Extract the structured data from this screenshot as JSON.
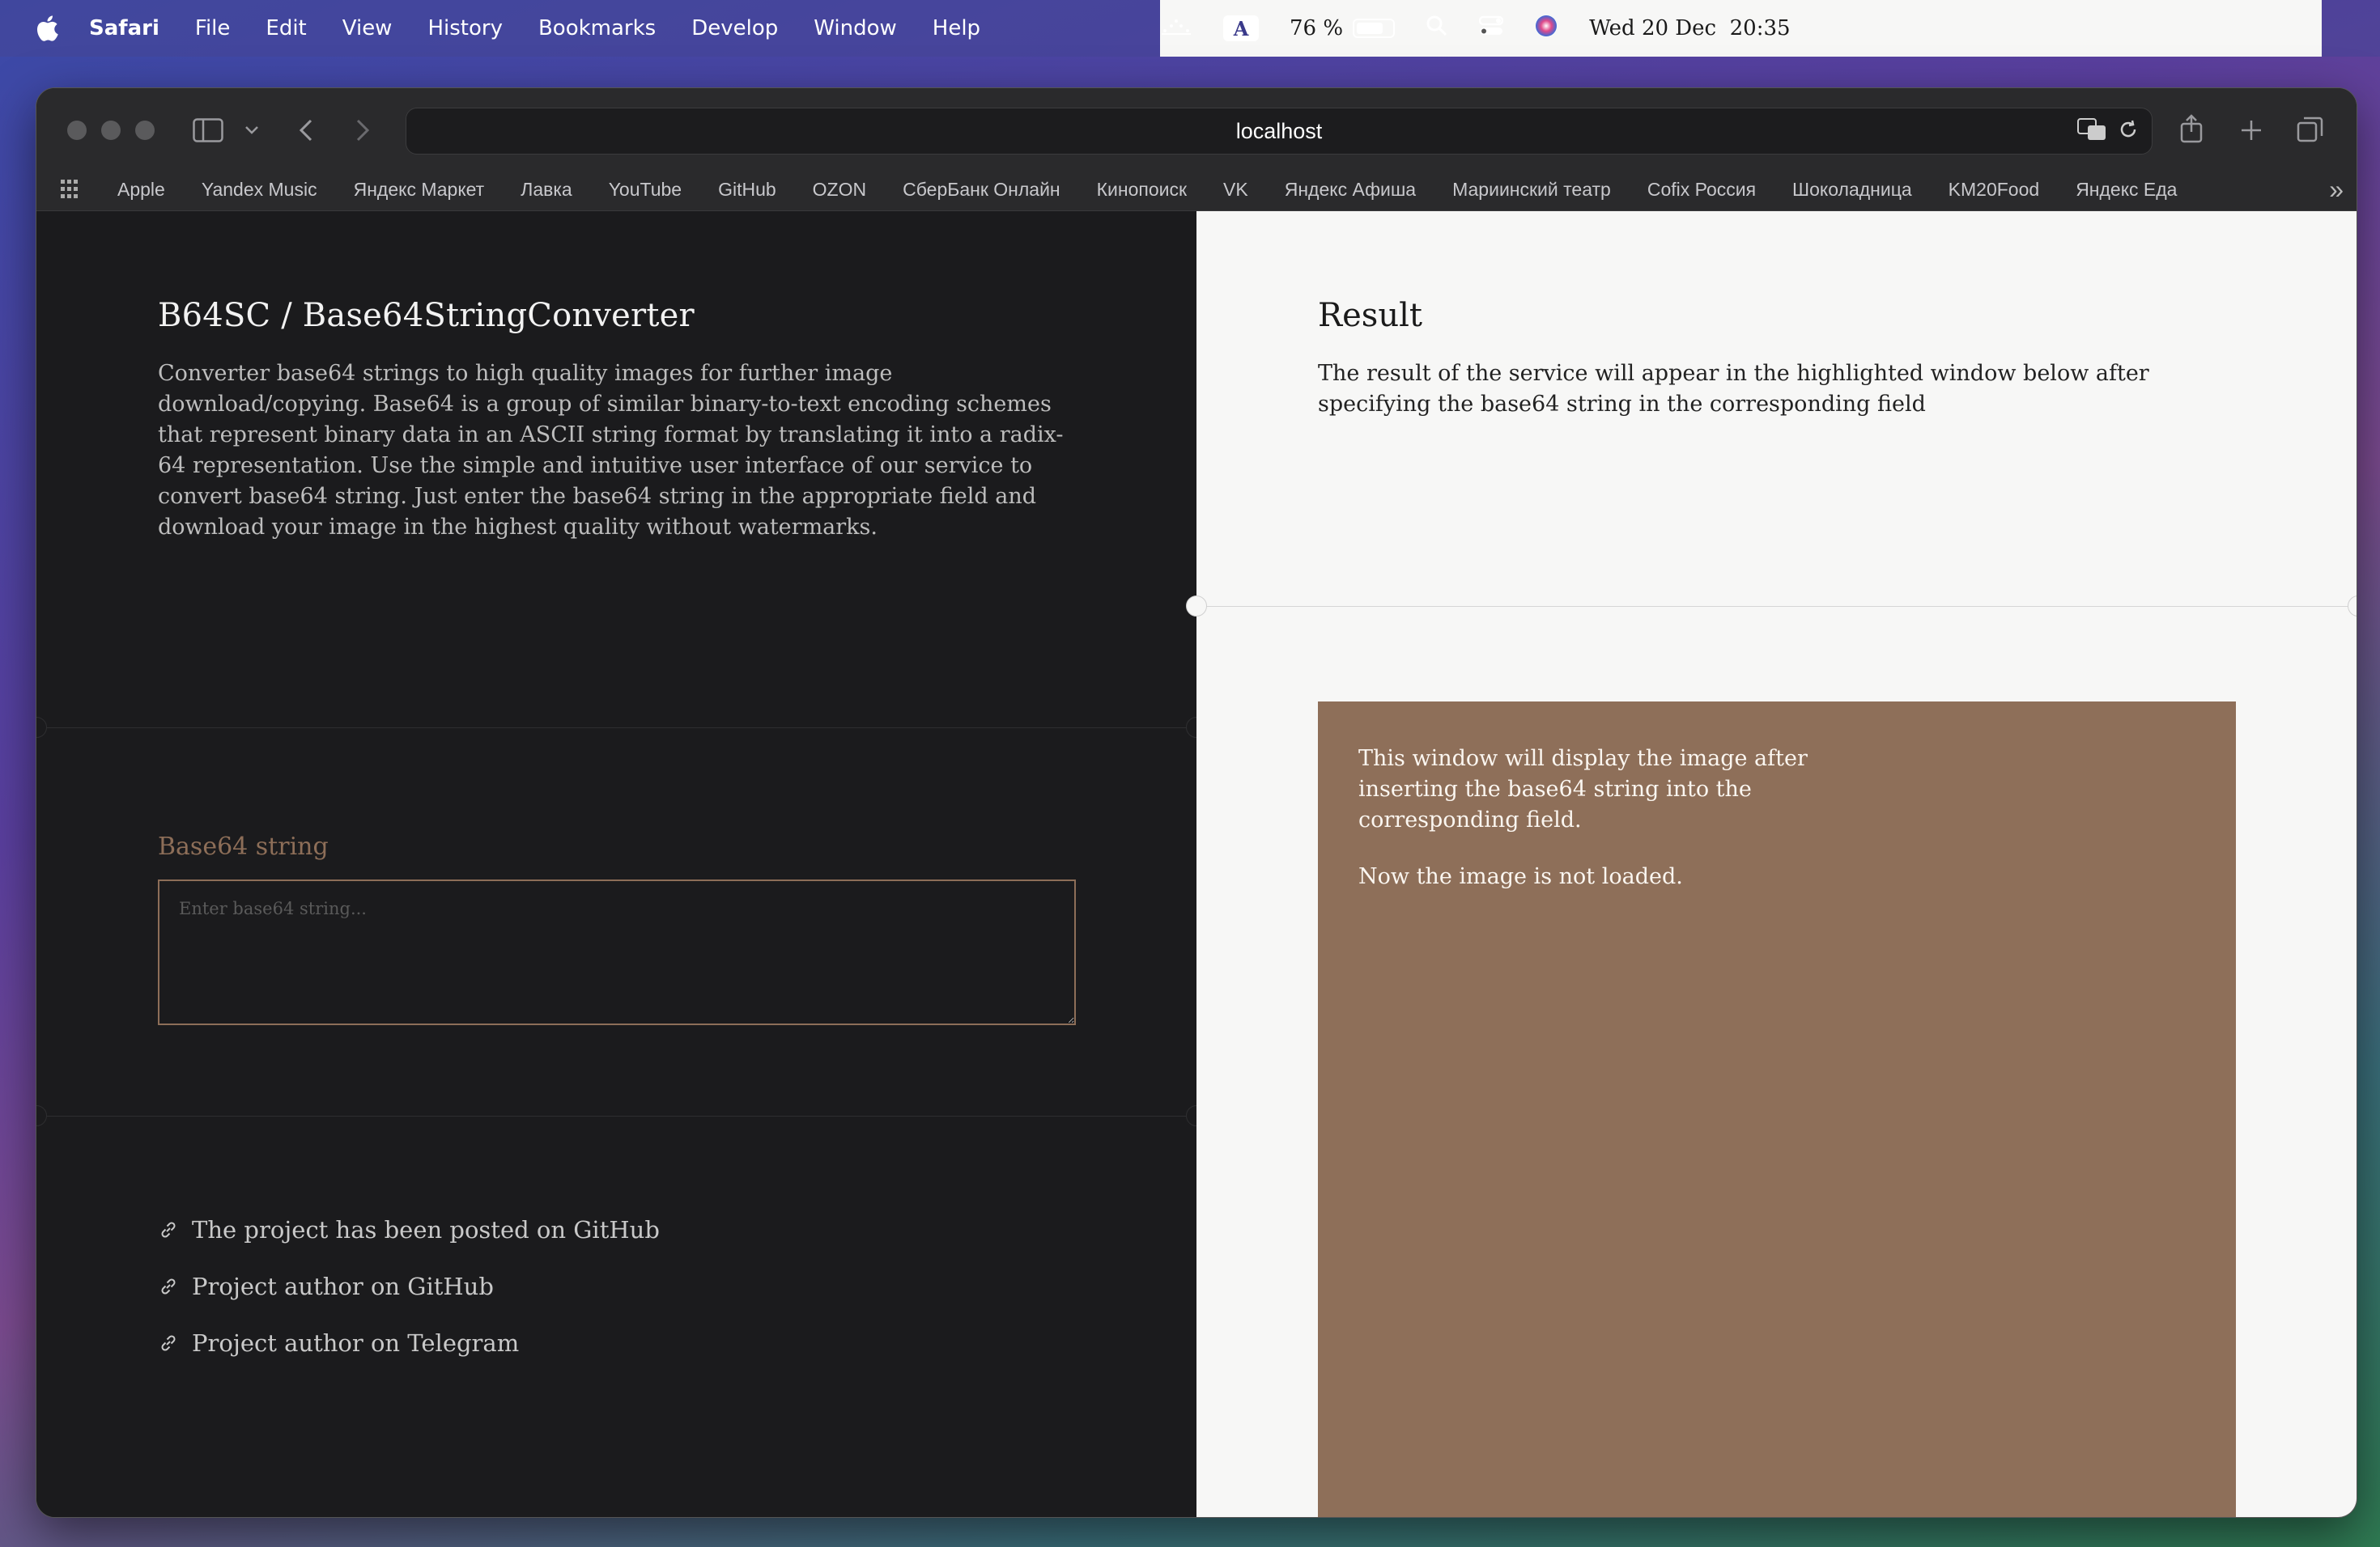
{
  "menubar": {
    "app_name": "Safari",
    "items": [
      "File",
      "Edit",
      "View",
      "History",
      "Bookmarks",
      "Develop",
      "Window",
      "Help"
    ],
    "battery_percent": "76 %",
    "battery_level": 0.76,
    "datetime": "Wed 20 Dec  20:35",
    "input_source": "A"
  },
  "browser": {
    "url": "localhost",
    "bookmarks": [
      "Apple",
      "Yandex Music",
      "Яндекс Маркет",
      "Лавка",
      "YouTube",
      "GitHub",
      "OZON",
      "СберБанк Онлайн",
      "Кинопоиск",
      "VK",
      "Яндекс Афиша",
      "Мариинский театр",
      "Cofix Россия",
      "Шоколадница",
      "KM20Food",
      "Яндекс Еда"
    ]
  },
  "left_panel": {
    "title": "B64SC / Base64StringConverter",
    "description": "Converter base64 strings to high quality images for further image download/copying. Base64 is a group of similar binary-to-text encoding schemes that represent binary data in an ASCII string format by translating it into a radix-64 representation. Use the simple and intuitive user interface of our service to convert base64 string. Just enter the base64 string in the appropriate field and download your image in the highest quality without watermarks.",
    "field_label": "Base64 string",
    "field_placeholder": "Enter base64 string...",
    "field_value": "",
    "links": [
      "The project has been posted on GitHub",
      "Project author on GitHub",
      "Project author on Telegram"
    ]
  },
  "right_panel": {
    "title": "Result",
    "description": "The result of the service will appear in the highlighted window below after specifying the base64 string in the corresponding field",
    "result_message_1": "This window will display the image after inserting the base64 string into the corresponding field.",
    "result_message_2": "Now the image is not loaded."
  },
  "colors": {
    "accent_brown": "#8e6f59",
    "dark_panel": "#1b1b1d",
    "light_panel": "#f7f7f6"
  }
}
